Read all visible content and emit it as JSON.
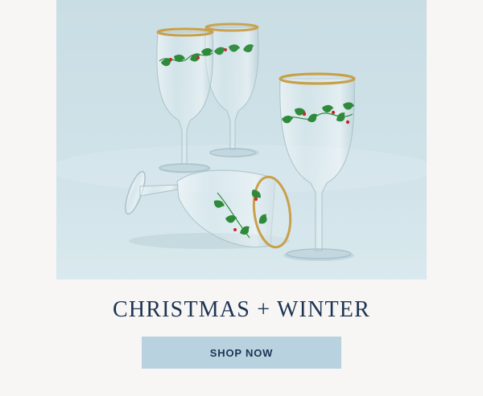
{
  "promo": {
    "image_alt": "Holly-patterned wine glasses with gold rims",
    "headline": "CHRISTMAS + WINTER",
    "cta_label": "SHOP NOW"
  },
  "colors": {
    "page_background": "#f7f6f4",
    "photo_background": "#cfe1e7",
    "headline_text": "#1c3452",
    "button_background": "#b8d3df",
    "holly_green": "#2e8a3a",
    "berry_red": "#c62a2a",
    "gold_rim": "#c9a04a"
  }
}
